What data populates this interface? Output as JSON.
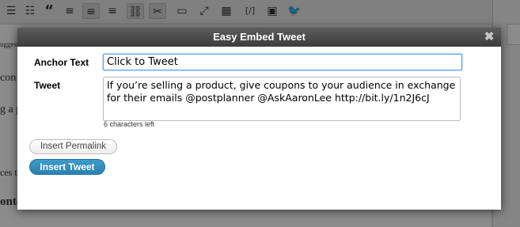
{
  "modal": {
    "title": "Easy Embed Tweet",
    "close_glyph": "✖",
    "anchor_label": "Anchor Text",
    "anchor_value": "Click to Tweet",
    "tweet_label": "Tweet",
    "tweet_value": "If you’re selling a product, give coupons to your audience in exchange for their emails @postplanner @AskAaronLee http://bit.ly/1n2J6cJ",
    "chars_left": "6 characters left",
    "insert_permalink_label": "Insert Permalink",
    "insert_tweet_label": "Insert Tweet"
  },
  "background": {
    "toolbar_icons": [
      "list-icon",
      "ordered-list-icon",
      "blockquote-icon",
      "align-left-icon",
      "align-center-icon",
      "align-right-icon",
      "link-icon",
      "unlink-icon",
      "insert-more-icon",
      "fullscreen-icon",
      "toolbar-toggle-icon",
      "shortcode-icon",
      "embed-icon",
      "twitter-icon"
    ],
    "partial_text": [
      "uggest",
      "con",
      "g a p",
      "ces t",
      "onte"
    ]
  },
  "colors": {
    "title_bar": "#4a4a4a",
    "primary_button": "#2e88b8",
    "input_focus": "#5b9dd9"
  }
}
